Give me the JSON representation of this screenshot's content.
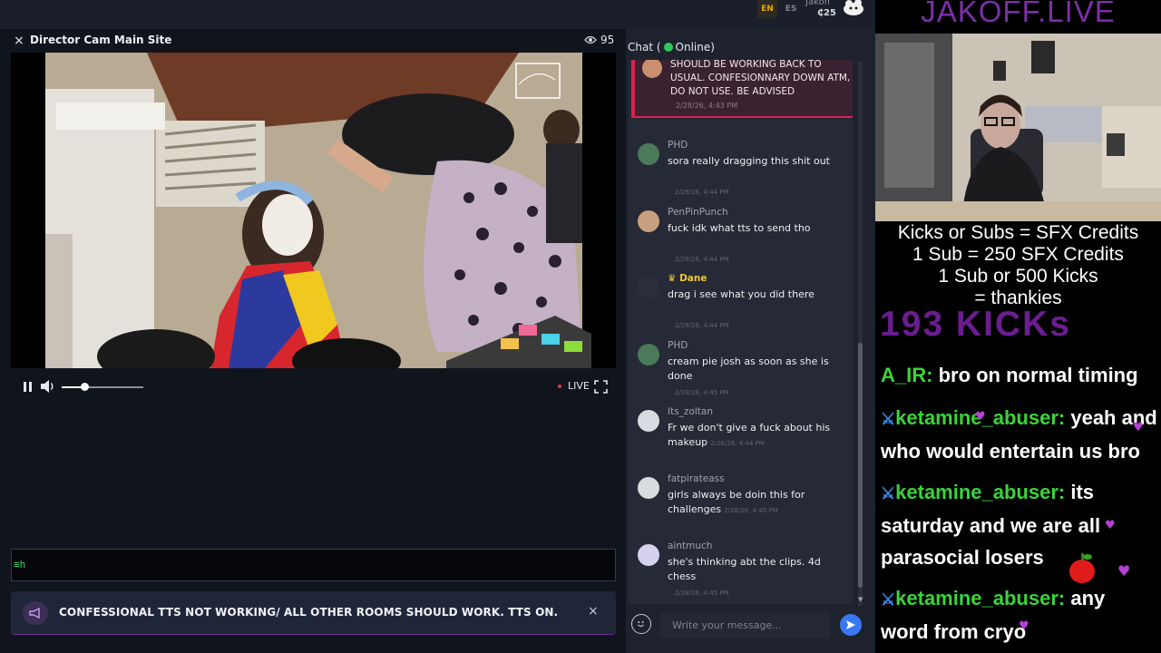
{
  "top_bar": {
    "languages": [
      "EN",
      "ES"
    ],
    "active_language": "EN",
    "user_name": "Jakoff",
    "credits": "₵25"
  },
  "player": {
    "close_glyph": "×",
    "title": "Director Cam Main Site",
    "viewer_count": "95",
    "live_label": "LIVE",
    "volume_level": 0.28,
    "tts_icon": "≡h"
  },
  "announcement": {
    "text": "CONFESSIONAL TTS NOT WORKING/ ALL OTHER ROOMS SHOULD WORK. TTS ON.",
    "close_glyph": "×"
  },
  "chat": {
    "header_prefix": "Chat (",
    "header_status": "Online)",
    "pinned": {
      "text": "SHOULD BE WORKING BACK TO USUAL. CONFESIONNARY DOWN ATM, DO NOT USE. BE ADVISED",
      "time": "2/28/26, 4:43 PM"
    },
    "messages": [
      {
        "user": "PHD",
        "text": "sora really dragging this shit out",
        "time": "2/28/26, 4:44 PM",
        "avatar_color": "#4a7a5a"
      },
      {
        "user": "PenPinPunch",
        "text": "fuck idk what tts to send tho",
        "time": "2/28/26, 4:44 PM",
        "avatar_color": "#c9a07f"
      },
      {
        "user": "Dane",
        "badge": "♛",
        "text": "drag i see what you did there",
        "time": "2/28/26, 4:44 PM",
        "avatar_color": "#2a2f3a"
      },
      {
        "user": "PHD",
        "text": "cream pie josh as soon as she is done",
        "time": "2/28/26, 4:45 PM",
        "avatar_color": "#4a7a5a"
      },
      {
        "user": "Its_zoltan",
        "text": "Fr we don't give a fuck about his makeup",
        "time": "2/28/26, 4:44 PM",
        "avatar_color": "#d8dbe0"
      },
      {
        "user": "fatpirateass",
        "text": "girls always be doin this for challenges",
        "time": "2/28/26, 4:45 PM",
        "avatar_color": "#d8dbe0"
      },
      {
        "user": "aintmuch",
        "text": "she's thinking abt the clips. 4d chess",
        "time": "2/28/26, 4:45 PM",
        "avatar_color": "#d4d2ee"
      }
    ],
    "input_placeholder": "Write your message..."
  },
  "overlay": {
    "title": "JAKOFF.LIVE",
    "lines": [
      "Kicks or Subs = SFX Credits",
      "1 Sub = 250 SFX Credits",
      "1 Sub or 500 Kicks",
      "= thankies"
    ],
    "kicks": "193 KICKs",
    "chat": [
      {
        "user": "A_IR:",
        "text": " bro on normal timing"
      },
      {
        "user": "ketamine_abuser:",
        "text": " yeah and who would entertain us bro"
      },
      {
        "user": "ketamine_abuser:",
        "text": " its saturday and we are all parasocial losers"
      },
      {
        "user": "ketamine_abuser:",
        "text": " any word from cryo"
      }
    ]
  },
  "colors": {
    "accent_blue": "#3a78f2",
    "online_green": "#2fc95b",
    "pinned_red": "#d6244e",
    "overlay_purple": "#7b2fa8",
    "overlay_name_green": "#3ad43a",
    "badge_gold": "#f0c43c"
  },
  "icons": [
    "close-icon",
    "eye-icon",
    "pause-icon",
    "volume-icon",
    "fullscreen-icon",
    "megaphone-icon",
    "emoji-icon",
    "send-icon",
    "crown-icon",
    "sword-icon",
    "heart-icon"
  ]
}
